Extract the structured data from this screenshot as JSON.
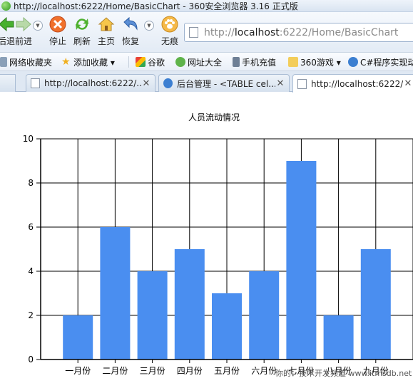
{
  "window": {
    "title": "http://localhost:6222/Home/BasicChart - 360安全浏览器 3.16 正式版",
    "top_watermark": "IT知识技术开发频道 www.itmsdb.net"
  },
  "toolbar": {
    "back_label": "后退",
    "forward_label": "前进",
    "stop_label": "停止",
    "refresh_label": "刷新",
    "home_label": "主页",
    "restore_label": "恢复",
    "incognito_label": "无痕"
  },
  "address": {
    "url_prefix": "http://",
    "url_host": "localhost",
    "url_rest": ":6222/Home/BasicChart"
  },
  "favorites": {
    "items": [
      {
        "label": "网络收藏夹"
      },
      {
        "label": "添加收藏 ▾"
      },
      {
        "label": "谷歌"
      },
      {
        "label": "网址大全"
      },
      {
        "label": "手机充值"
      },
      {
        "label": "360游戏 ▾"
      },
      {
        "label": "C#程序实现动"
      }
    ]
  },
  "tabs": [
    {
      "label": "http://localhost:6222/...",
      "close": "✕"
    },
    {
      "label": "后台管理 - <TABLE cel...",
      "close": "✕"
    },
    {
      "label": "http://localhost:6222/...",
      "close": "✕"
    }
  ],
  "colors": {
    "bar": "#4a8ef0",
    "grid": "#000000"
  },
  "chart_data": {
    "type": "bar",
    "title": "人员流动情况",
    "categories": [
      "一月份",
      "二月份",
      "三月份",
      "四月份",
      "五月份",
      "六月份",
      "七月份",
      "八月份",
      "九月份"
    ],
    "values": [
      2,
      6,
      4,
      5,
      3,
      4,
      9,
      2,
      5
    ],
    "ylim": [
      0,
      10
    ],
    "yticks": [
      0,
      2,
      4,
      6,
      8,
      10
    ],
    "xlabel": "",
    "ylabel": "",
    "grid": true
  },
  "watermark": "你的：技术开发频道 www.itmsdb.net"
}
